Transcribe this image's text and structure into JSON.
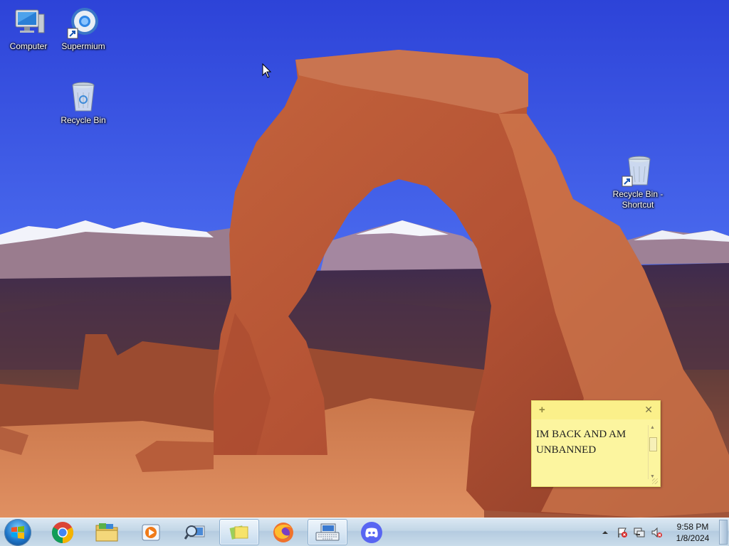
{
  "desktop": {
    "icons": [
      {
        "label": "Computer",
        "icon": "computer-icon"
      },
      {
        "label": "Supermium",
        "icon": "supermium-browser-icon"
      },
      {
        "label": "Recycle Bin",
        "icon": "recycle-bin-icon"
      },
      {
        "label": "Recycle Bin - Shortcut",
        "icon": "recycle-bin-shortcut-icon"
      }
    ]
  },
  "sticky_note": {
    "text": "IM BACK AND AM UNBANNED",
    "add_glyph": "+",
    "close_glyph": "✕",
    "color": "#fcf59f"
  },
  "taskbar": {
    "pinned": [
      {
        "name": "chrome",
        "icon": "chrome-icon"
      },
      {
        "name": "file-explorer",
        "icon": "folder-icon"
      },
      {
        "name": "media-player",
        "icon": "media-player-icon"
      },
      {
        "name": "magnifier",
        "icon": "magnifier-icon"
      },
      {
        "name": "sticky-notes",
        "icon": "sticky-notes-icon",
        "active": true
      },
      {
        "name": "firefox",
        "icon": "firefox-icon"
      },
      {
        "name": "on-screen-keyboard",
        "icon": "keyboard-icon",
        "active": true
      },
      {
        "name": "discord",
        "icon": "discord-icon"
      }
    ],
    "tray": {
      "icons": [
        "show-hidden-icon",
        "action-center-icon",
        "network-icon",
        "volume-muted-icon"
      ],
      "time": "9:58 PM",
      "date": "1/8/2024"
    }
  }
}
